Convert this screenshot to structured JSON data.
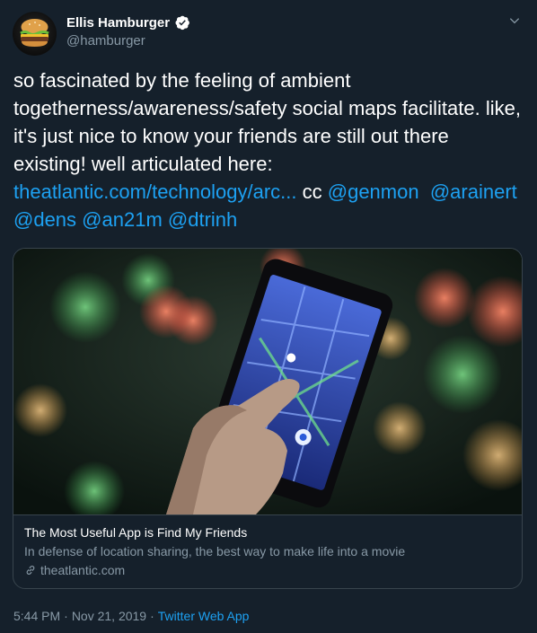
{
  "author": {
    "display_name": "Ellis Hamburger",
    "handle": "@hamburger",
    "verified": true,
    "avatar_icon": "hamburger-avatar"
  },
  "tweet": {
    "text": "so fascinated by the feeling of ambient togetherness/awareness/safety social maps facilitate. like, it's just nice to know your friends are still out there existing! well articulated here:",
    "link_text": "theatlantic.com/technology/arc...",
    "cc_text": "cc",
    "mentions": [
      "@genmon",
      "@arainert",
      "@dens",
      "@an21m",
      "@dtrinh"
    ]
  },
  "card": {
    "title": "The Most Useful App is Find My Friends",
    "description": "In defense of location sharing, the best way to make life into a movie",
    "domain": "theatlantic.com",
    "domain_icon": "link-icon",
    "image_icon": "phone-map-photo"
  },
  "footer": {
    "time": "5:44 PM",
    "separator1": "·",
    "date": "Nov 21, 2019",
    "separator2": "·",
    "app": "Twitter Web App"
  },
  "colors": {
    "background": "#15202b",
    "link": "#1da1f2",
    "secondary_text": "#8899a6",
    "border": "#38444d",
    "verified": "#ffffff"
  }
}
